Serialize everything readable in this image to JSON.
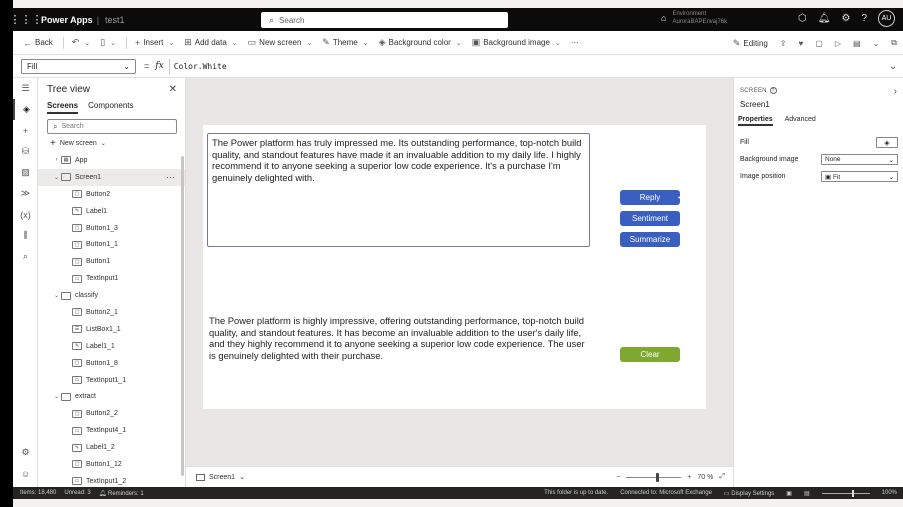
{
  "appbar": {
    "app_name": "Power Apps",
    "app_title": "test1",
    "search_placeholder": "Search",
    "env_line1": "Environment",
    "env_line2": "AuroraBAPEnvaj76k",
    "avatar_initials": "AU",
    "icons": [
      "environment-icon",
      "copilot-icon",
      "bell-icon",
      "gear-icon",
      "help-icon"
    ]
  },
  "cmdbar": {
    "back": "Back",
    "insert": "Insert",
    "add_data": "Add data",
    "new_screen": "New screen",
    "theme": "Theme",
    "background_color": "Background color",
    "background_image": "Background image",
    "more": "···",
    "editing": "Editing"
  },
  "formula_bar": {
    "property": "Fill",
    "equals": "=",
    "fx": "fx",
    "formula": "Color.White"
  },
  "tree": {
    "title": "Tree view",
    "tabs": [
      "Screens",
      "Components"
    ],
    "search_placeholder": "Search",
    "new_screen": "New screen",
    "nodes": [
      {
        "label": "App",
        "level": 0,
        "expander": "›",
        "icon": "app-icon"
      },
      {
        "label": "Screen1",
        "level": 0,
        "expander": "⌄",
        "icon": "screen-icon",
        "selected": true
      },
      {
        "label": "Button2",
        "level": 1,
        "icon": "button-icon"
      },
      {
        "label": "Label1",
        "level": 1,
        "icon": "label-icon"
      },
      {
        "label": "Button1_3",
        "level": 1,
        "icon": "button-icon"
      },
      {
        "label": "Button1_1",
        "level": 1,
        "icon": "button-icon"
      },
      {
        "label": "Button1",
        "level": 1,
        "icon": "button-icon"
      },
      {
        "label": "TextInput1",
        "level": 1,
        "icon": "textinput-icon"
      },
      {
        "label": "classify",
        "level": 0,
        "expander": "⌄",
        "icon": "screen-icon"
      },
      {
        "label": "Button2_1",
        "level": 1,
        "icon": "button-icon"
      },
      {
        "label": "ListBox1_1",
        "level": 1,
        "icon": "listbox-icon"
      },
      {
        "label": "Label1_1",
        "level": 1,
        "icon": "label-icon"
      },
      {
        "label": "Button1_8",
        "level": 1,
        "icon": "button-icon"
      },
      {
        "label": "TextInput1_1",
        "level": 1,
        "icon": "textinput-icon"
      },
      {
        "label": "extract",
        "level": 0,
        "expander": "⌄",
        "icon": "screen-icon"
      },
      {
        "label": "Button2_2",
        "level": 1,
        "icon": "button-icon"
      },
      {
        "label": "TextInput4_1",
        "level": 1,
        "icon": "textinput-icon"
      },
      {
        "label": "Label1_2",
        "level": 1,
        "icon": "label-icon"
      },
      {
        "label": "Button1_12",
        "level": 1,
        "icon": "button-icon"
      },
      {
        "label": "TextInput1_2",
        "level": 1,
        "icon": "textinput-icon"
      }
    ]
  },
  "canvas": {
    "input_text": "The Power platform has truly impressed me. Its outstanding performance, top-notch build quality, and standout features have made it an invaluable addition to my daily life. I highly recommend it to anyone seeking a superior low code experience. It's a purchase I'm genuinely delighted with.",
    "output_text": "The Power platform is highly impressive, offering outstanding performance, top-notch build quality, and standout features. It has become an invaluable addition to the user's daily life, and they highly recommend it to anyone seeking a superior low code experience. The user is genuinely delighted with their purchase.",
    "buttons": {
      "reply": "Reply",
      "sentiment": "Sentiment",
      "summarize": "Summarize",
      "clear": "Clear"
    },
    "colors": {
      "primary_button": "#3b5fc0",
      "clear_button": "#7ea82f"
    }
  },
  "canvas_footer": {
    "screen": "Screen1",
    "zoom_minus": "−",
    "zoom_plus": "+",
    "zoom_value": "70",
    "zoom_unit": "%",
    "zoom_fraction": 0.7
  },
  "props": {
    "kind": "SCREEN",
    "name": "Screen1",
    "tabs": [
      "Properties",
      "Advanced"
    ],
    "fill_label": "Fill",
    "bg_image_label": "Background image",
    "bg_image_value": "None",
    "img_pos_label": "Image position",
    "img_pos_value": "Fit"
  },
  "status": {
    "items": "Items: 18,480",
    "unread": "Unread: 3",
    "reminders": "Reminders: 1",
    "uptodate": "This folder is up to date.",
    "connected": "Connected to: Microsoft Exchange",
    "display": "Display Settings",
    "zoom": "100%"
  }
}
